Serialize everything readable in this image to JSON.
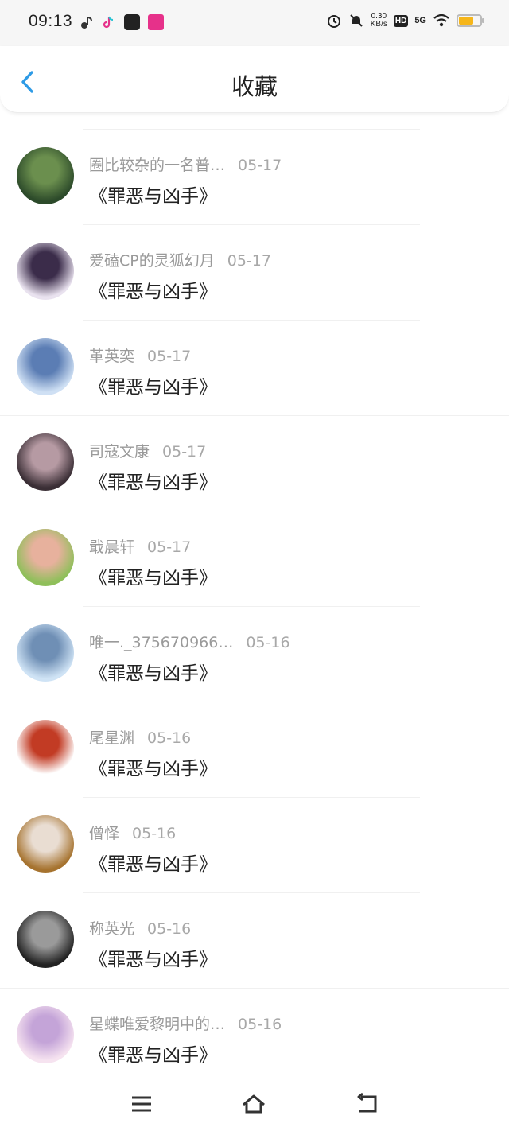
{
  "status": {
    "time": "09:13",
    "net_speed": "0.30",
    "net_unit": "KB/s",
    "hd": "HD",
    "signal": "5G"
  },
  "header": {
    "title": "收藏"
  },
  "items": [
    {
      "name": "圈比较杂的一名普…",
      "date": "05-17",
      "book": "《罪恶与凶手》",
      "avatar_colors": [
        "#2c4a2a",
        "#6b8f4e"
      ]
    },
    {
      "name": "爱磕CP的灵狐幻月",
      "date": "05-17",
      "book": "《罪恶与凶手》",
      "avatar_colors": [
        "#e9e2ef",
        "#3b2c4a"
      ]
    },
    {
      "name": "革英奕",
      "date": "05-17",
      "book": "《罪恶与凶手》",
      "avatar_colors": [
        "#cfe0f4",
        "#5b7db4"
      ]
    },
    {
      "name": "司寇文康",
      "date": "05-17",
      "book": "《罪恶与凶手》",
      "avatar_colors": [
        "#3a2e35",
        "#b69aa3"
      ]
    },
    {
      "name": "戢晨轩",
      "date": "05-17",
      "book": "《罪恶与凶手》",
      "avatar_colors": [
        "#8fbf5a",
        "#e7b19d"
      ]
    },
    {
      "name": "唯一._375670966…",
      "date": "05-16",
      "book": "《罪恶与凶手》",
      "avatar_colors": [
        "#cfe3f5",
        "#6f8fb5"
      ]
    },
    {
      "name": "尾星渊",
      "date": "05-16",
      "book": "《罪恶与凶手》",
      "avatar_colors": [
        "#ffffff",
        "#c23b24"
      ]
    },
    {
      "name": "僧怿",
      "date": "05-16",
      "book": "《罪恶与凶手》",
      "avatar_colors": [
        "#a6732f",
        "#e9ddd2"
      ]
    },
    {
      "name": "称英光",
      "date": "05-16",
      "book": "《罪恶与凶手》",
      "avatar_colors": [
        "#222222",
        "#9a9a9a"
      ]
    },
    {
      "name": "星蝶唯爱黎明中的…",
      "date": "05-16",
      "book": "《罪恶与凶手》",
      "avatar_colors": [
        "#f6e3f0",
        "#c4a4d8"
      ]
    }
  ],
  "colors": {
    "accent": "#2e9be6",
    "name_gray": "#9a9a9a",
    "title": "#222222"
  }
}
